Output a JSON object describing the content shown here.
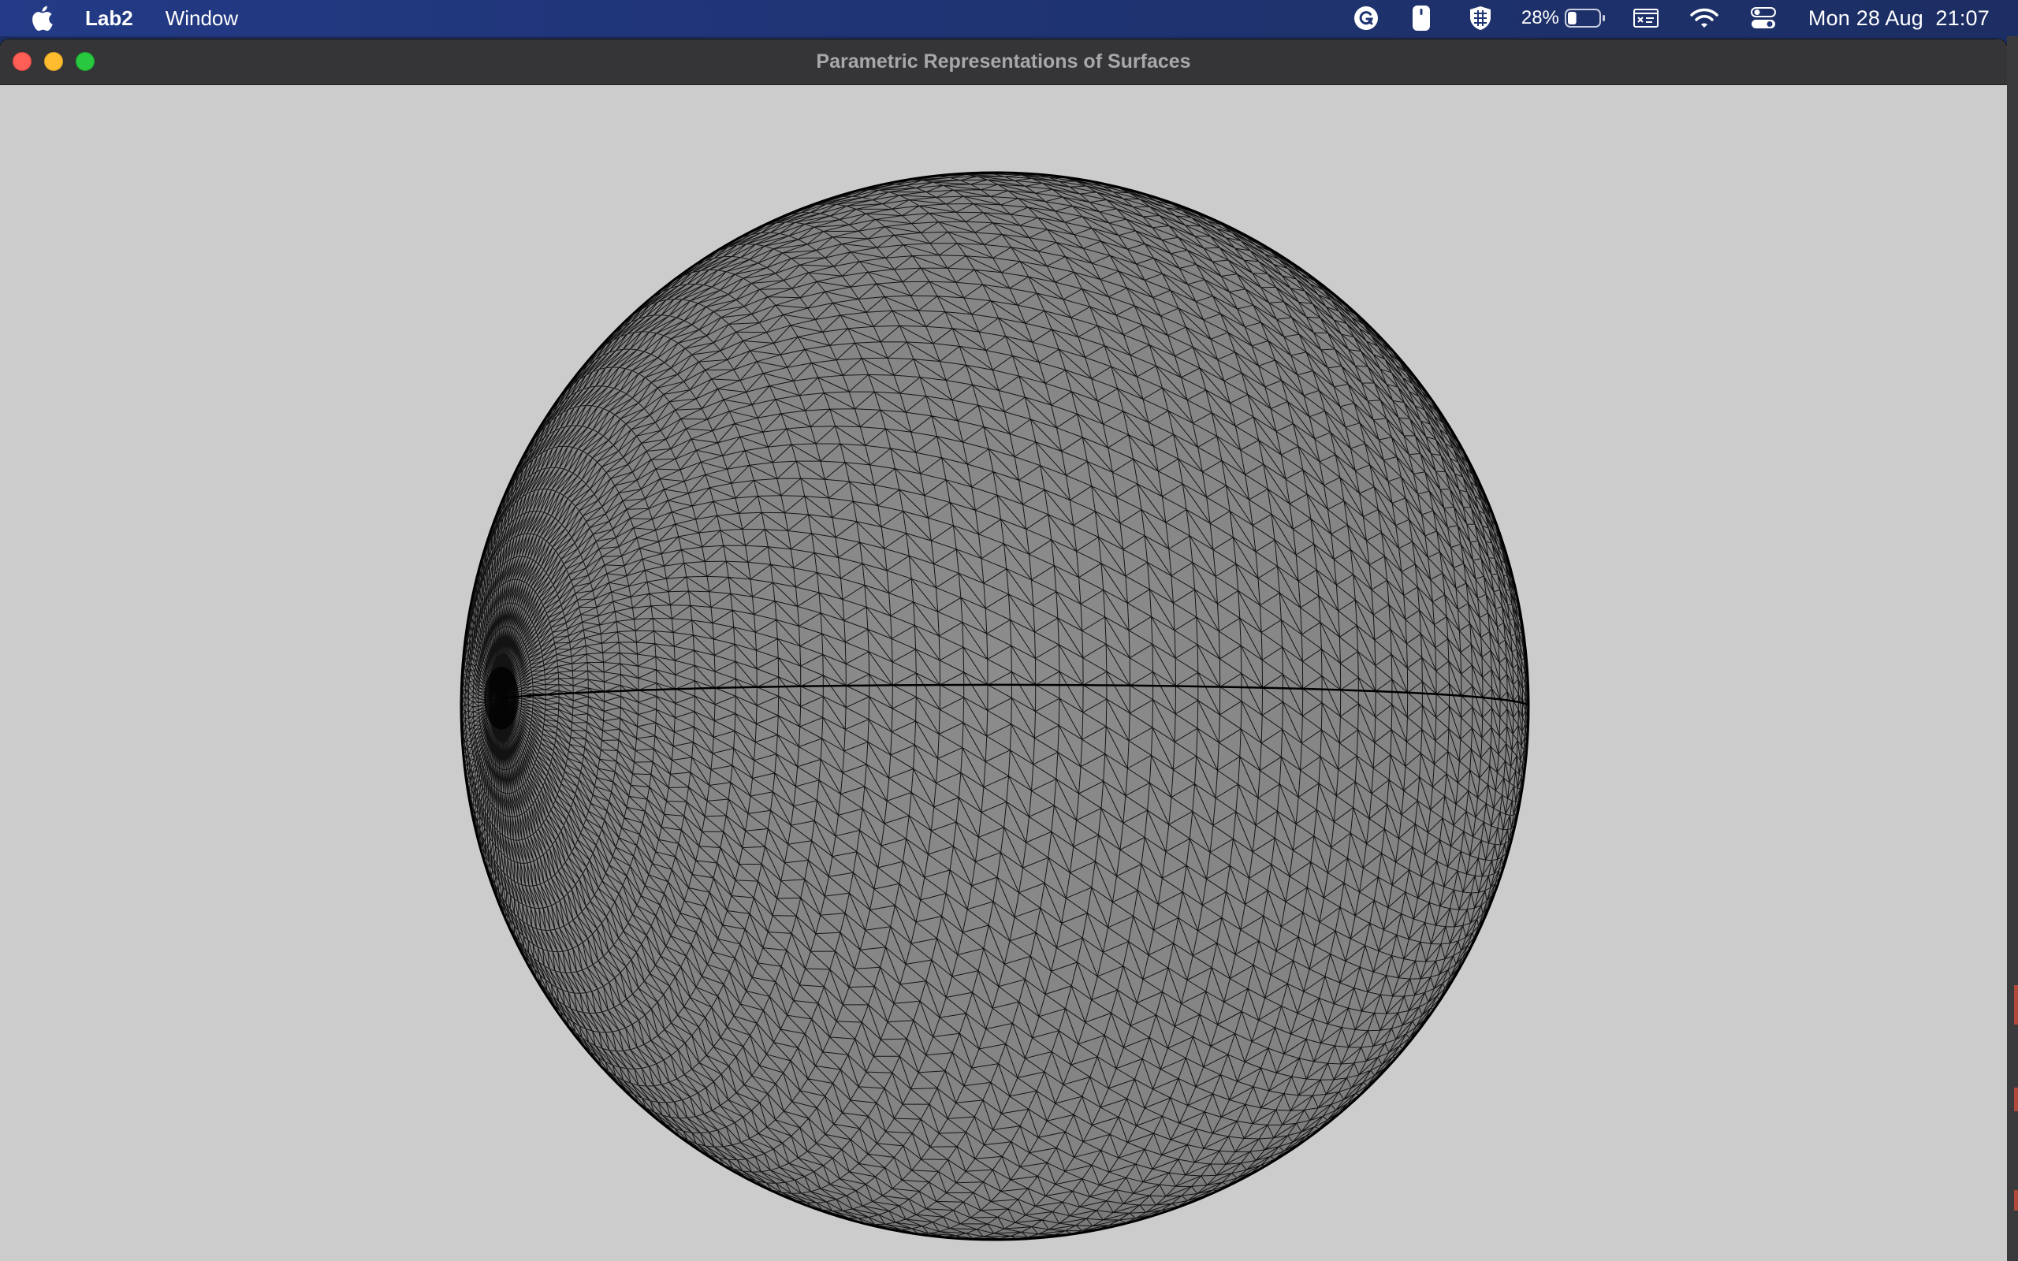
{
  "menubar": {
    "apple_icon": "apple-logo-icon",
    "app_name": "Lab2",
    "menus": [
      "Window"
    ],
    "status": {
      "grammarly_icon": "grammarly-icon",
      "mouse_icon": "mouse-icon",
      "vpn_icon": "shield-grid-icon",
      "battery_percent": "28%",
      "battery_level": 0.28,
      "display_icon": "display-icon",
      "wifi_icon": "wifi-icon",
      "control_center_icon": "control-center-icon",
      "date": "Mon 28 Aug",
      "time": "21:07"
    }
  },
  "window": {
    "title": "Parametric Representations of Surfaces",
    "buttons": [
      "close",
      "minimize",
      "zoom"
    ],
    "background_color": "#cccccc"
  },
  "surface": {
    "type": "sphere-wireframe",
    "fill_color": "#8a8a8a",
    "line_color": "#000000",
    "rendering": "triangle mesh"
  }
}
